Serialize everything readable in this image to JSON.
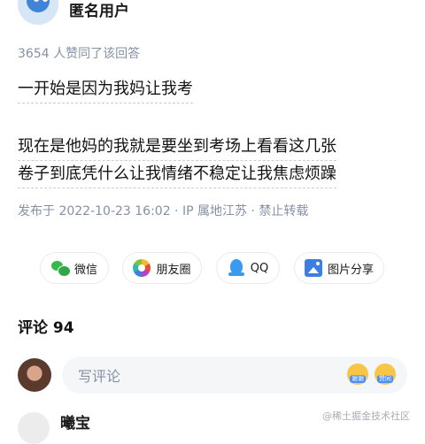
{
  "answer": {
    "author_name": "匿名用户",
    "upvote_text": "3654 人赞同了该回答",
    "paragraphs": [
      [
        "一开始是因为我妈让我考"
      ],
      [
        "现在是他妈的我就是要坐到考场上看看这几张",
        "卷子到底凭什么让我情绪不稳定让我焦虑烦躁"
      ]
    ],
    "publish_text": "发布于 2022-10-23 16:02 · IP 属地江苏 · 禁止转载"
  },
  "share": {
    "wechat": "微信",
    "moments": "朋友圈",
    "qq": "QQ",
    "image": "图片分享"
  },
  "comments": {
    "title": "评论 94",
    "input_placeholder": "写评论",
    "emoji_1": "谢谢",
    "emoji_2": "赞同",
    "next_commenter": "曦宝"
  },
  "watermark": "@稀土掘金技术社区"
}
